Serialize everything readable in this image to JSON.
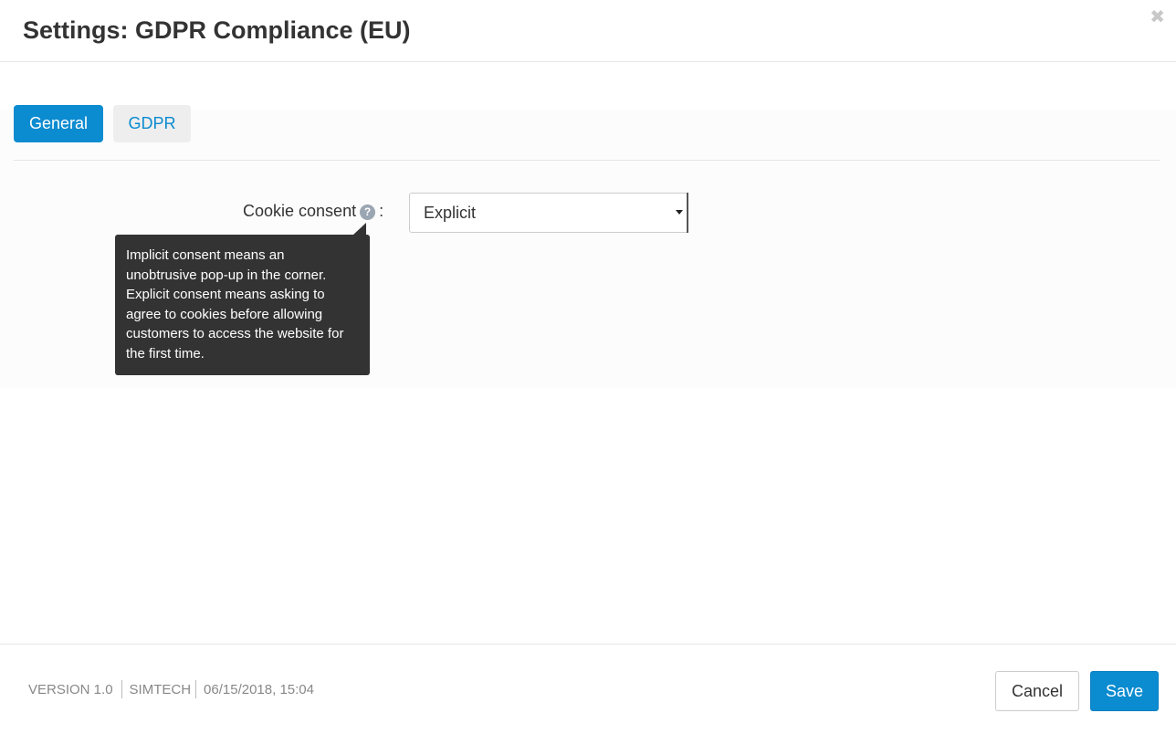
{
  "window": {
    "title": "Settings: GDPR Compliance (EU)",
    "close_glyph": "✖"
  },
  "tabs": [
    {
      "label": "General",
      "active": true
    },
    {
      "label": "GDPR",
      "active": false
    }
  ],
  "form": {
    "cookie_consent": {
      "label": "Cookie consent",
      "help_glyph": "?",
      "colon": ":",
      "value": "Explicit",
      "tooltip": "Implicit consent means an unobtrusive pop-up in the corner. Explicit consent means asking to agree to cookies before allowing customers to access the website for the first time."
    }
  },
  "footer": {
    "version": "VERSION 1.0",
    "vendor": "SIMTECH",
    "date": "06/15/2018, 15:04",
    "cancel_label": "Cancel",
    "save_label": "Save"
  },
  "colors": {
    "accent": "#0b8bd0",
    "tooltip_bg": "#333333",
    "tab_inactive_bg": "#eeeeee"
  },
  "icons": {
    "close": "close-icon",
    "help": "help-icon",
    "dropdown": "chevron-down-icon"
  }
}
